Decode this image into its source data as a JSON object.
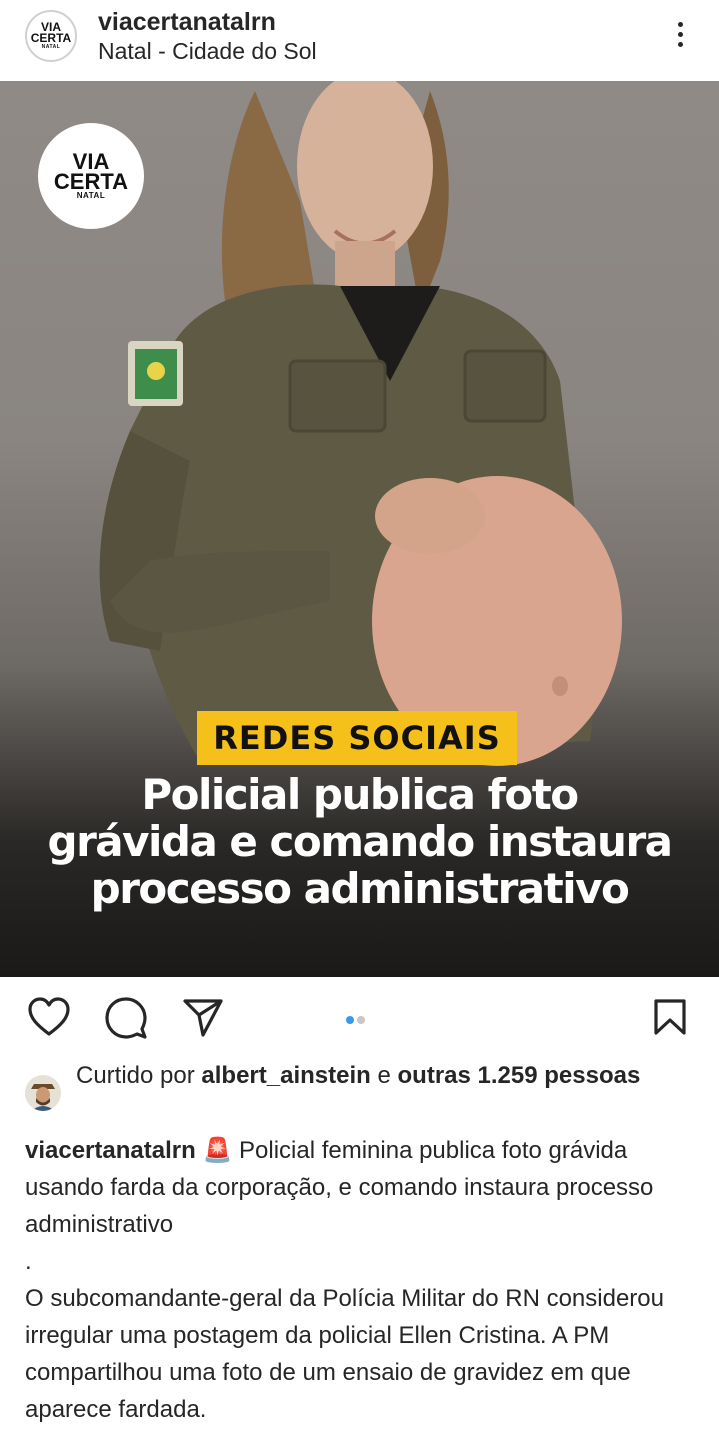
{
  "header": {
    "username": "viacertanatalrn",
    "location": "Natal - Cidade do Sol",
    "logo_line1": "VIA",
    "logo_line2": "CERTA",
    "logo_line3": "NATAL"
  },
  "post": {
    "badge_logo_line1": "VIA",
    "badge_logo_line2": "CERTA",
    "badge_logo_line3": "NATAL",
    "tag": "REDES SOCIAIS",
    "headline": [
      "Policial publica foto",
      "grávida e comando instaura",
      "processo administrativo"
    ],
    "carousel_position": 1,
    "carousel_count": 2
  },
  "likes": {
    "prefix": "Curtido por",
    "liker": "albert_ainstein",
    "connector": "e",
    "others": "outras 1.259",
    "suffix": "pessoas"
  },
  "caption": {
    "username": "viacertanatalrn",
    "emoji": "🚨",
    "text1": "Policial feminina publica foto grávida usando farda da corporação, e comando instaura processo administrativo",
    "separator": ".",
    "text2": "O subcomandante-geral da Polícia Militar do RN considerou irregular uma postagem da policial Ellen Cristina. A PM compartilhou uma foto de um ensaio de gravidez em que aparece fardada."
  },
  "colors": {
    "accent_blue": "#3897f0",
    "tag_yellow": "#f5c01a",
    "text": "#262626"
  },
  "icons": [
    "more-vertical-icon",
    "heart-icon",
    "comment-icon",
    "share-icon",
    "bookmark-icon"
  ]
}
